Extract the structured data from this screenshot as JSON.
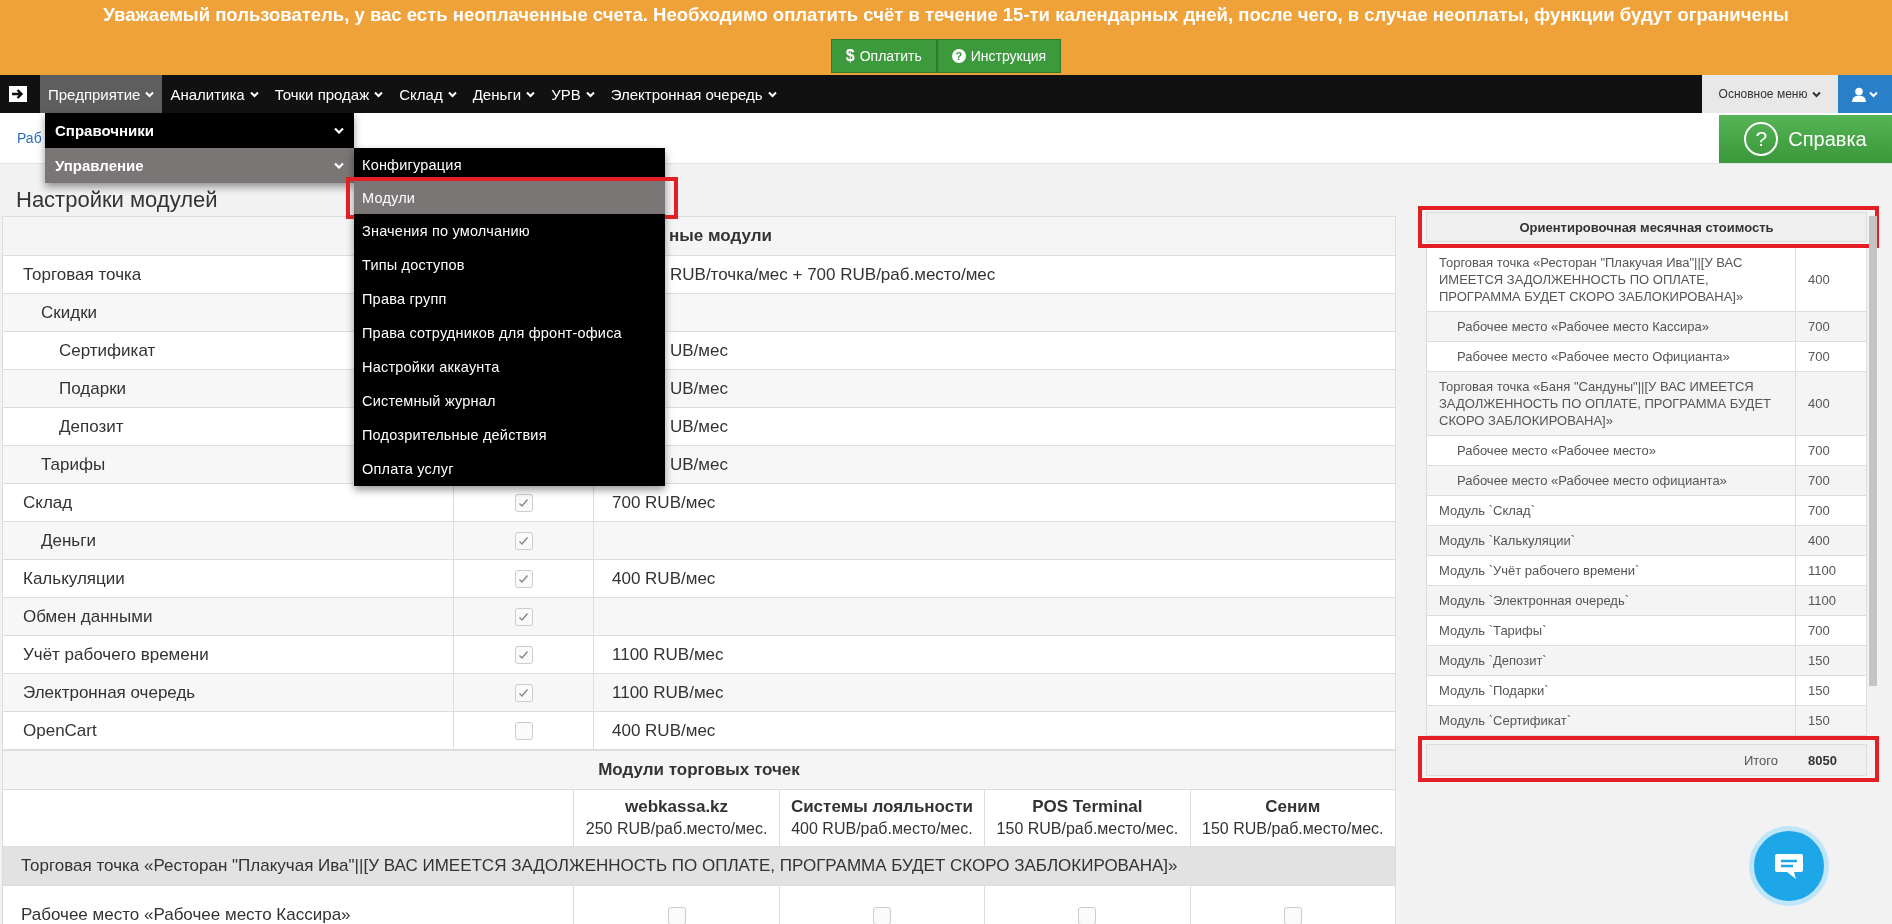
{
  "banner": {
    "message": "Уважаемый пользователь, у вас есть неоплаченные счета. Необходимо оплатить счёт в течение 15-ти календарных дней, после чего, в случае неоплаты, функции будут ограничены",
    "buttons": [
      {
        "kind": "pay",
        "icon": "$",
        "label": "Оплатить"
      },
      {
        "kind": "help",
        "icon": "?",
        "label": "Инструкция"
      }
    ]
  },
  "navbar": {
    "items": [
      {
        "label": "Предприятие",
        "selected": true
      },
      {
        "label": "Аналитика",
        "selected": false
      },
      {
        "label": "Точки продаж",
        "selected": false
      },
      {
        "label": "Склад",
        "selected": false
      },
      {
        "label": "Деньги",
        "selected": false
      },
      {
        "label": "УРВ",
        "selected": false
      },
      {
        "label": "Электронная очередь",
        "selected": false
      }
    ],
    "main_menu": "Основное меню"
  },
  "enterprise_menu": {
    "items": [
      {
        "label": "Справочники",
        "selected": false
      },
      {
        "label": "Управление",
        "selected": true
      }
    ]
  },
  "management_submenu": {
    "items": [
      {
        "label": "Конфигурация",
        "selected": false,
        "highlighted": false
      },
      {
        "label": "Модули",
        "selected": true,
        "highlighted": true
      },
      {
        "label": "Значения по умолчанию",
        "selected": false,
        "highlighted": false
      },
      {
        "label": "Типы доступов",
        "selected": false,
        "highlighted": false
      },
      {
        "label": "Права групп",
        "selected": false,
        "highlighted": false
      },
      {
        "label": "Права сотрудников для фронт-офиса",
        "selected": false,
        "highlighted": false
      },
      {
        "label": "Настройки аккаунта",
        "selected": false,
        "highlighted": false
      },
      {
        "label": "Системный журнал",
        "selected": false,
        "highlighted": false
      },
      {
        "label": "Подозрительные действия",
        "selected": false,
        "highlighted": false
      },
      {
        "label": "Оплата услуг",
        "selected": false,
        "highlighted": false
      }
    ]
  },
  "breadcrumb": "Раб",
  "help_button": {
    "icon": "?",
    "label": "Справка"
  },
  "page_title": "Настройки модулей",
  "modules_table": {
    "heading": "ные модули",
    "rows": [
      {
        "name": "Торговая точка",
        "price": "RUB/точка/мес + 700 RUB/раб.место/мес",
        "children": [
          {
            "name": "Скидки",
            "children": [
              {
                "name": "Сертификат",
                "price": "UB/мес"
              },
              {
                "name": "Подарки",
                "price": "UB/мес"
              },
              {
                "name": "Депозит",
                "price": "UB/мес"
              }
            ]
          },
          {
            "name": "Тарифы",
            "price": "UB/мес"
          }
        ]
      },
      {
        "name": "Склад",
        "price": "700 RUB/мес",
        "checked": true,
        "children": [
          {
            "name": "Деньги",
            "checked": true
          }
        ]
      },
      {
        "name": "Калькуляции",
        "price": "400 RUB/мес",
        "checked": true
      },
      {
        "name": "Обмен данными",
        "checked": true
      },
      {
        "name": "Учёт рабочего времени",
        "price": "1100 RUB/мес",
        "checked": true
      },
      {
        "name": "Электронная очередь",
        "price": "1100 RUB/мес",
        "checked": true
      },
      {
        "name": "OpenCart",
        "price": "400 RUB/мес",
        "checked": false
      }
    ]
  },
  "outlet_modules": {
    "heading": "Модули торговых точек",
    "columns": [
      {
        "name": "webkassa.kz",
        "price": "250 RUB/раб.место/мес."
      },
      {
        "name": "Системы лояльности",
        "price": "400 RUB/раб.место/мес."
      },
      {
        "name": "POS Terminal",
        "price": "150 RUB/раб.место/мес."
      },
      {
        "name": "Сеним",
        "price": "150 RUB/раб.место/мес."
      }
    ],
    "outlets": [
      {
        "name": "Торговая точка «Ресторан \"Плакучая Ива\"||[У ВАС ИМЕЕТСЯ ЗАДОЛЖЕННОСТЬ ПО ОПЛАТЕ, ПРОГРАММА БУДЕТ СКОРО ЗАБЛОКИРОВАНА]»",
        "workplaces": [
          {
            "name": "Рабочее место «Рабочее место Кассира»",
            "modules": [
              {
                "checked": false
              },
              {
                "checked": false
              },
              {
                "checked": false
              },
              {
                "checked": false
              }
            ]
          }
        ]
      }
    ]
  },
  "cost_panel": {
    "heading": "Ориентировочная месячная стоимость",
    "highlighted": true,
    "items": [
      {
        "name": "Торговая точка «Ресторан \"Плакучая Ива\"||[У ВАС ИМЕЕТСЯ ЗАДОЛЖЕННОСТЬ ПО ОПЛАТЕ, ПРОГРАММА БУДЕТ СКОРО ЗАБЛОКИРОВАНА]»",
        "amount": "400",
        "children": [
          {
            "name": "Рабочее место «Рабочее место Кассира»",
            "amount": "700"
          },
          {
            "name": "Рабочее место «Рабочее место Официанта»",
            "amount": "700"
          }
        ]
      },
      {
        "name": "Торговая точка «Баня \"Сандуны\"||[У ВАС ИМЕЕТСЯ ЗАДОЛЖЕННОСТЬ ПО ОПЛАТЕ, ПРОГРАММА БУДЕТ СКОРО ЗАБЛОКИРОВАНА]»",
        "amount": "400",
        "children": [
          {
            "name": "Рабочее место «Рабочее место»",
            "amount": "700"
          },
          {
            "name": "Рабочее место «Рабочее место официанта»",
            "amount": "700"
          }
        ]
      },
      {
        "name": "Модуль `Склад`",
        "amount": "700"
      },
      {
        "name": "Модуль `Калькуляции`",
        "amount": "400"
      },
      {
        "name": "Модуль `Учёт рабочего времени`",
        "amount": "1100"
      },
      {
        "name": "Модуль `Электронная очередь`",
        "amount": "1100"
      },
      {
        "name": "Модуль `Тарифы`",
        "amount": "700"
      },
      {
        "name": "Модуль `Депозит`",
        "amount": "150"
      },
      {
        "name": "Модуль `Подарки`",
        "amount": "150"
      },
      {
        "name": "Модуль `Сертификат`",
        "amount": "150"
      }
    ],
    "total": {
      "label": "Итого",
      "amount": "8050",
      "highlighted": true
    }
  }
}
